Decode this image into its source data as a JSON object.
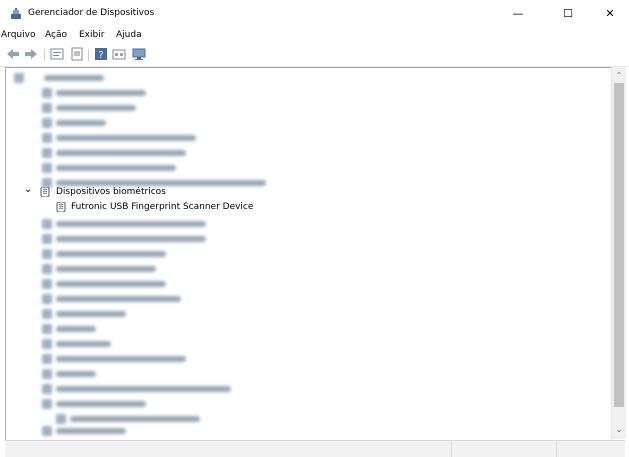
{
  "window": {
    "title": "Gerenciador de Dispositivos",
    "minimize_label": "—",
    "maximize_label": "☐",
    "close_label": "✕"
  },
  "menu": [
    {
      "label": "Arquivo"
    },
    {
      "label": "Ação"
    },
    {
      "label": "Exibir"
    },
    {
      "label": "Ajuda"
    }
  ],
  "toolbar": {
    "icons": [
      "back-icon",
      "forward-icon",
      "properties-icon",
      "update-icon",
      "help-icon",
      "resources-icon",
      "monitor-icon"
    ]
  },
  "tree": {
    "expanded_category": "Dispositivos biométricos",
    "expanded_category_arrow": "⌄",
    "device": "Futronic USB Fingerprint Scanner Device"
  },
  "scrollbar": {
    "up_arrow": "⌃",
    "down_arrow": "⌄"
  }
}
